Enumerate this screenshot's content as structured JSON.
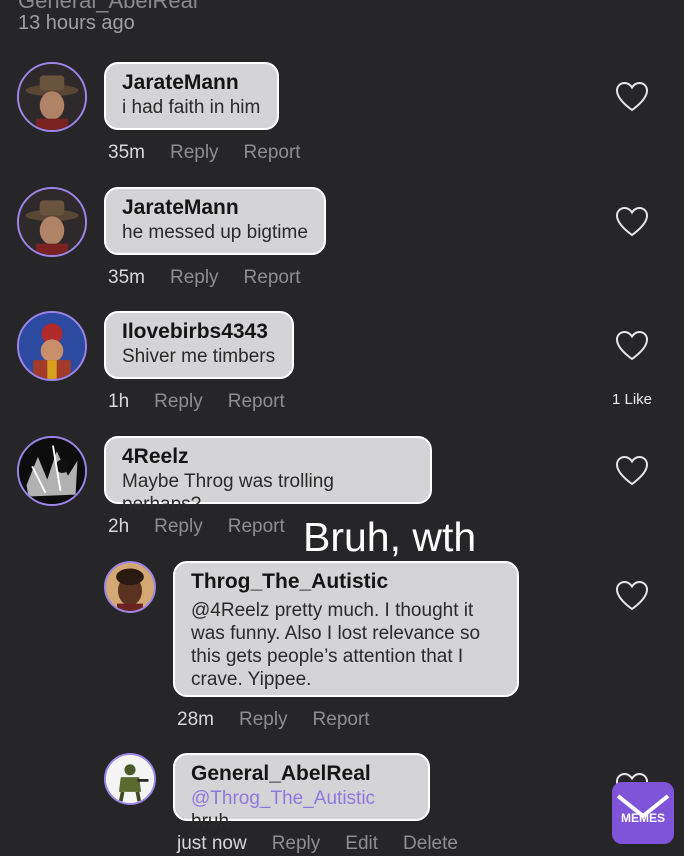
{
  "post": {
    "username": "General_AbelReal",
    "time": "13 hours ago"
  },
  "comments": [
    {
      "user": "JarateMann",
      "text": "i had faith in him",
      "time": "35m",
      "reply": "Reply",
      "report": "Report"
    },
    {
      "user": "JarateMann",
      "text": "he messed up bigtime",
      "time": "35m",
      "reply": "Reply",
      "report": "Report"
    },
    {
      "user": "Ilovebirbs4343",
      "text": "Shiver me timbers",
      "time": "1h",
      "reply": "Reply",
      "report": "Report",
      "likes": "1 Like"
    },
    {
      "user": "4Reelz",
      "text": "Maybe Throg was trolling perhaps?",
      "time": "2h",
      "reply": "Reply",
      "report": "Report"
    },
    {
      "user": "Throg_The_Autistic",
      "text": "@4Reelz pretty much. I thought it was funny. Also I lost relevance so this gets people’s attention that I crave. Yippee.",
      "time": "28m",
      "reply": "Reply",
      "report": "Report"
    },
    {
      "user": "General_AbelReal",
      "mention": "@Throg_The_Autistic",
      "text": "bruh",
      "time": "just now",
      "reply": "Reply",
      "edit": "Edit",
      "delete": "Delete"
    }
  ],
  "overlay": "Bruh, wth",
  "badge": "MEMES",
  "colors": {
    "background": "#262628",
    "bubble": "#d4d4d6",
    "accent": "#9d84e8",
    "mention": "#8e78e0",
    "badge": "#7f54d8"
  }
}
